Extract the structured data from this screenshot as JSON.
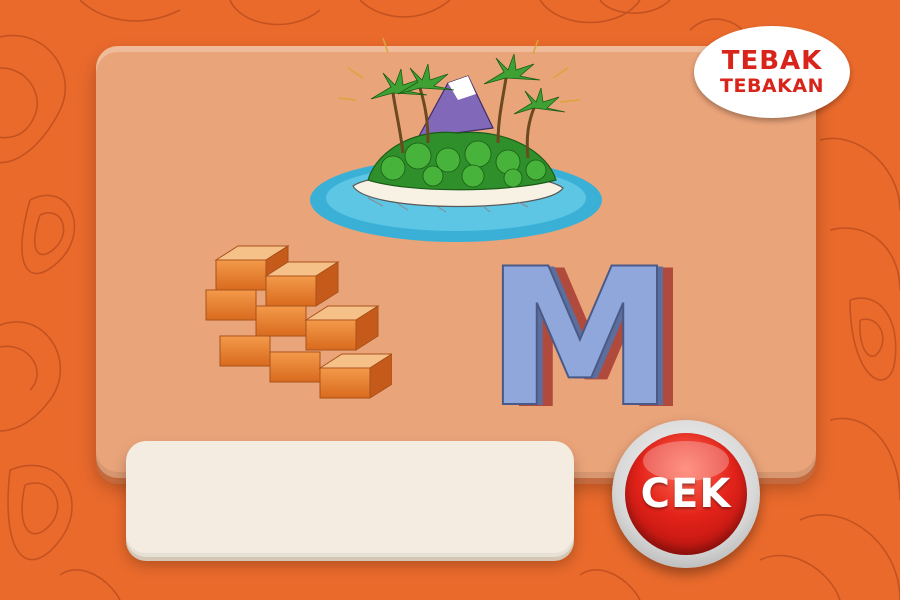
{
  "logo": {
    "line1": "TEBAK",
    "line2": "TEBAKAN"
  },
  "clues": [
    {
      "name": "island",
      "icon": "island-picture"
    },
    {
      "name": "bricks",
      "icon": "brick-wall-picture"
    },
    {
      "name": "letter",
      "icon": "letter-m-picture",
      "letter": "M"
    }
  ],
  "answer": {
    "value": "",
    "placeholder": ""
  },
  "check_button": {
    "label": "CEK"
  },
  "colors": {
    "background": "#ea6a2c",
    "card": "#eaa47a",
    "answer_box": "#f4ece0",
    "button_red": "#e3231a",
    "logo_red": "#d9241b",
    "letter_blue": "#8fa7da"
  }
}
